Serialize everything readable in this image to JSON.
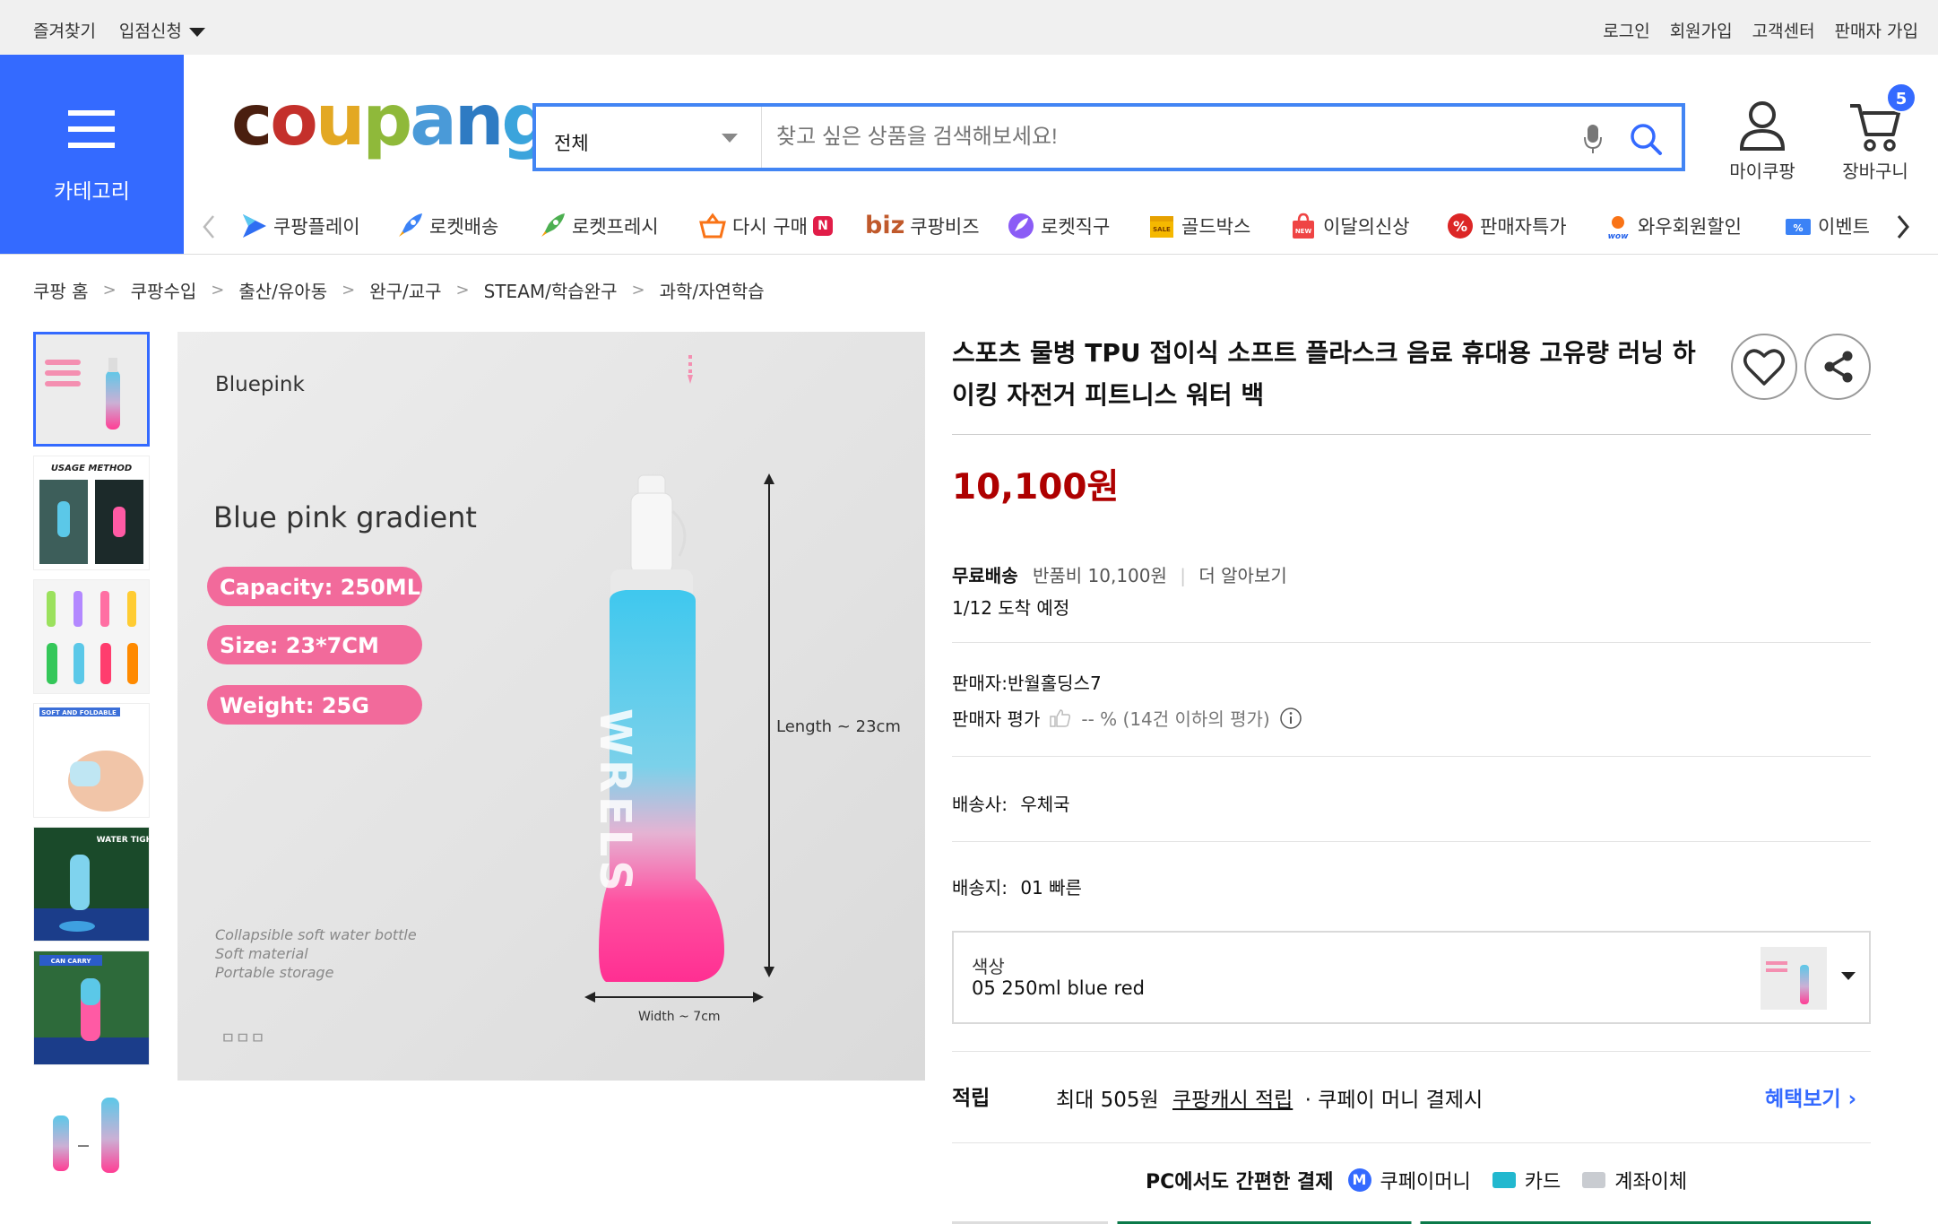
{
  "topbar": {
    "bookmark": "즐겨찾기",
    "store_apply": "입점신청",
    "login": "로그인",
    "signup": "회원가입",
    "customer_center": "고객센터",
    "seller_signup": "판매자 가입"
  },
  "category_button": {
    "label": "카테고리"
  },
  "logo": {
    "text": "coupang",
    "colors": [
      "#4a1f0f",
      "#c4302b",
      "#e3a823",
      "#8fb93a",
      "#4a9ad8",
      "#2e7bc3",
      "#3ba4dc"
    ]
  },
  "search": {
    "scope": "전체",
    "placeholder": "찾고 싶은 상품을 검색해보세요!"
  },
  "header_icons": {
    "my_coupang": "마이쿠팡",
    "cart": "장바구니",
    "cart_count": "5"
  },
  "nav": {
    "items": [
      {
        "label": "쿠팡플레이",
        "icon": "play-icon"
      },
      {
        "label": "로켓배송",
        "icon": "rocket-icon"
      },
      {
        "label": "로켓프레시",
        "icon": "rocket-fresh-icon"
      },
      {
        "label": "다시 구매",
        "icon": "basket-icon",
        "badge": "N"
      },
      {
        "label": "쿠팡비즈",
        "prefix": "biz",
        "icon": "biz-icon"
      },
      {
        "label": "로켓직구",
        "icon": "global-rocket-icon"
      },
      {
        "label": "골드박스",
        "icon": "goldbox-icon"
      },
      {
        "label": "이달의신상",
        "icon": "new-bag-icon"
      },
      {
        "label": "판매자특가",
        "icon": "percent-badge-icon"
      },
      {
        "label": "와우회원할인",
        "icon": "wow-icon"
      },
      {
        "label": "이벤트",
        "icon": "event-icon"
      }
    ]
  },
  "breadcrumb": [
    "쿠팡 홈",
    "쿠팡수입",
    "출산/유아동",
    "완구/교구",
    "STEAM/학습완구",
    "과학/자연학습"
  ],
  "main_image": {
    "variant": "Bluepink",
    "heading": "Blue pink gradient",
    "pills": [
      "Capacity: 250ML",
      "Size: 23*7CM",
      "Weight: 25G"
    ],
    "length_label": "Length ~ 23cm",
    "width_label": "Width ~ 7cm",
    "captions": [
      "Collapsible soft water bottle",
      "Soft material",
      "Portable storage"
    ],
    "brand": "WRELS",
    "small_mark": "ㅁㅁㅁ"
  },
  "thumb_texts": {
    "t2": "USAGE METHOD",
    "t4": "SOFT AND FOLDABLE",
    "t5": "WATER TIGHT",
    "t6": "CAN CARRY"
  },
  "product": {
    "title": "스포츠 물병 TPU 접이식 소프트 플라스크 음료 휴대용 고유량 러닝 하이킹 자전거 피트니스 워터 백",
    "price": "10,100원",
    "free_shipping": "무료배송",
    "return_fee": "반품비 10,100원",
    "more": "더 알아보기",
    "arrival": "1/12 도착 예정",
    "seller": "판매자:반월홀딩스7",
    "seller_rating_label": "판매자 평가",
    "seller_rating_value": "-- % (14건 이하의 평가)",
    "courier_label": "배송사:",
    "courier": "우체국",
    "origin_label": "배송지:",
    "origin": "01 빠른",
    "option_label": "색상",
    "option_value": "05 250ml blue red",
    "points_label": "적립",
    "points_text_1": "최대 505원",
    "points_link": "쿠팡캐시 적립",
    "points_text_2": "· 쿠페이 머니 결제시",
    "benefit_link": "혜택보기",
    "pc_pay": "PC에서도 간편한 결제",
    "pay_money": "쿠페이머니",
    "pay_card": "카드",
    "pay_bank": "계좌이체"
  },
  "colors": {
    "brand_blue": "#346aff",
    "price_red": "#ae0000",
    "search_border": "#4285f4"
  }
}
